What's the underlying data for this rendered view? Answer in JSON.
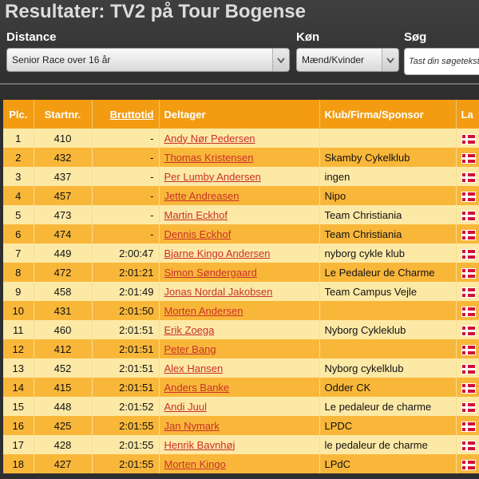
{
  "page": {
    "title": "Resultater: TV2 på Tour Bogense"
  },
  "filters": {
    "distance_label": "Distance",
    "distance_value": "Senior Race over 16 år",
    "gender_label": "Køn",
    "gender_value": "Mænd/Kvinder",
    "search_label": "Søg",
    "search_placeholder": "Tast din søgetekst"
  },
  "table": {
    "headers": {
      "place": "Plc.",
      "start": "Startnr.",
      "gross": "Bruttotid",
      "participant": "Deltager",
      "club": "Klub/Firma/Sponsor",
      "country": "La"
    },
    "rows": [
      {
        "place": "1",
        "start": "410",
        "time": "-",
        "name": "Andy Nør Pedersen",
        "club": ""
      },
      {
        "place": "2",
        "start": "432",
        "time": "-",
        "name": "Thomas Kristensen",
        "club": "Skamby Cykelklub"
      },
      {
        "place": "3",
        "start": "437",
        "time": "-",
        "name": "Per Lumby Andersen",
        "club": "ingen"
      },
      {
        "place": "4",
        "start": "457",
        "time": "-",
        "name": "Jette Andreasen",
        "club": "Nipo"
      },
      {
        "place": "5",
        "start": "473",
        "time": "-",
        "name": "Martin Eckhof",
        "club": "Team Christiania"
      },
      {
        "place": "6",
        "start": "474",
        "time": "-",
        "name": "Dennis Eckhof",
        "club": "Team Christiania"
      },
      {
        "place": "7",
        "start": "449",
        "time": "2:00:47",
        "name": "Bjarne Kingo Andersen",
        "club": "nyborg cykle klub"
      },
      {
        "place": "8",
        "start": "472",
        "time": "2:01:21",
        "name": "Simon Søndergaard",
        "club": "Le Pedaleur de Charme"
      },
      {
        "place": "9",
        "start": "458",
        "time": "2:01:49",
        "name": "Jonas Nordal Jakobsen",
        "club": "Team Campus Vejle"
      },
      {
        "place": "10",
        "start": "431",
        "time": "2:01:50",
        "name": "Morten Andersen",
        "club": ""
      },
      {
        "place": "11",
        "start": "460",
        "time": "2:01:51",
        "name": "Erik Zoega",
        "club": "Nyborg Cykleklub"
      },
      {
        "place": "12",
        "start": "412",
        "time": "2:01:51",
        "name": "Peter Bang",
        "club": ""
      },
      {
        "place": "13",
        "start": "452",
        "time": "2:01:51",
        "name": "Alex Hansen",
        "club": "Nyborg cykelklub"
      },
      {
        "place": "14",
        "start": "415",
        "time": "2:01:51",
        "name": "Anders Banke",
        "club": "Odder CK"
      },
      {
        "place": "15",
        "start": "448",
        "time": "2:01:52",
        "name": "Andi Juul",
        "club": "Le pedaleur de charme"
      },
      {
        "place": "16",
        "start": "425",
        "time": "2:01:55",
        "name": "Jan Nymark",
        "club": "LPDC"
      },
      {
        "place": "17",
        "start": "428",
        "time": "2:01:55",
        "name": "Henrik Bavnhøj",
        "club": "le pedaleur de charme"
      },
      {
        "place": "18",
        "start": "427",
        "time": "2:01:55",
        "name": "Morten Kingo",
        "club": "LPdC"
      }
    ]
  },
  "icons": {
    "flag": "denmark-flag-icon",
    "select_caret": "chevron-down-icon"
  },
  "colors": {
    "header": "#f39c12",
    "row_light": "#fde9a6",
    "row_dark": "#f9b73a",
    "link": "#c9302c"
  }
}
